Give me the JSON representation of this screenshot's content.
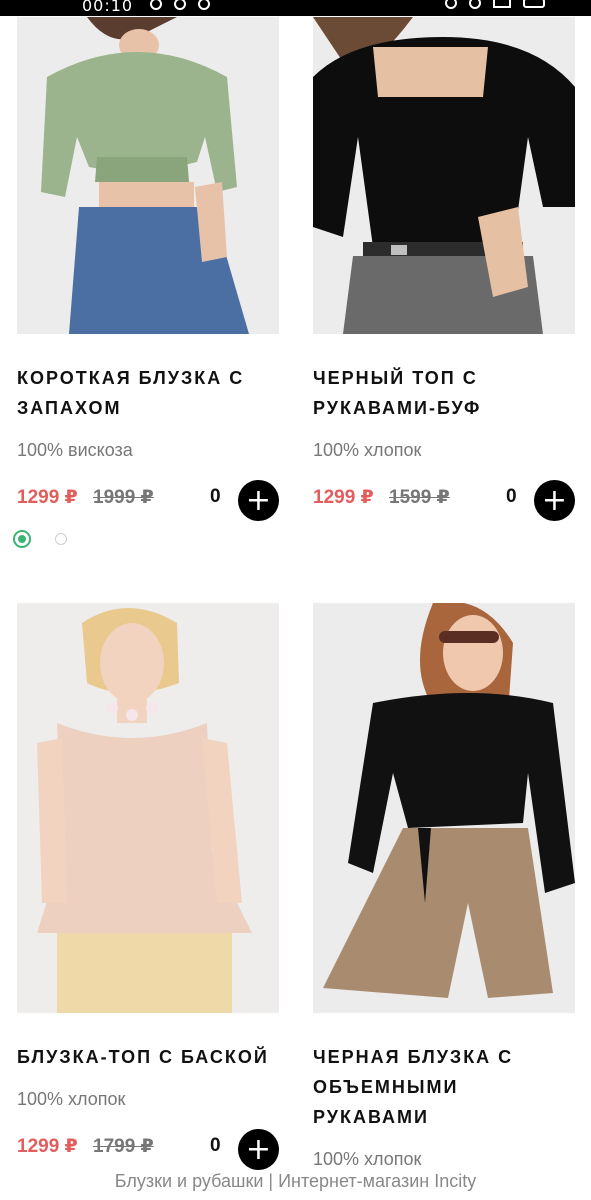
{
  "status_bar": {
    "time": "00:10"
  },
  "products": [
    {
      "title": "КОРОТКАЯ БЛУЗКА С\nЗАПАХОМ",
      "material": "100% вискоза",
      "price_sale": "1299 ₽",
      "price_old": "1999 ₽",
      "quantity": "0",
      "add_label": "+"
    },
    {
      "title": "ЧЕРНЫЙ ТОП С\nРУКАВАМИ-БУФ",
      "material": "100% хлопок",
      "price_sale": "1299 ₽",
      "price_old": "1599 ₽",
      "quantity": "0",
      "add_label": "+"
    },
    {
      "title": "БЛУЗКА-ТОП С БАСКОЙ",
      "material": "100% хлопок",
      "price_sale": "1299 ₽",
      "price_old": "1799 ₽",
      "quantity": "0",
      "add_label": "+"
    },
    {
      "title": "ЧЕРНАЯ БЛУЗКА С\nОБЪЕМНЫМИ\nРУКАВАМИ",
      "material": "100% хлопок"
    }
  ],
  "footer": {
    "page_title": "Блузки и рубашки | Интернет-магазин Incity"
  },
  "colors": {
    "sale_price": "#e35d5d",
    "swatch_active": "#3cb371",
    "button_bg": "#000000"
  }
}
